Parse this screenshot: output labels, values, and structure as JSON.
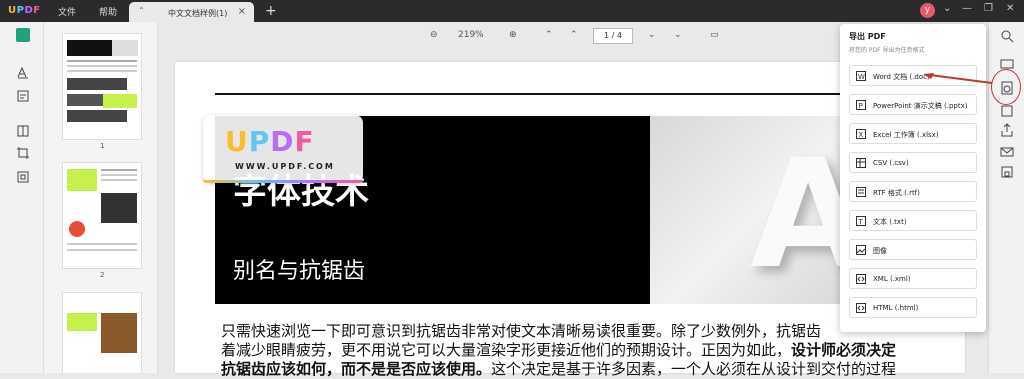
{
  "app": {
    "logo": "UPDF"
  },
  "menu": {
    "file": "文件",
    "help": "帮助"
  },
  "tab": {
    "title": "中文文档样例(1)"
  },
  "user": {
    "avatar_letter": "y"
  },
  "toolbar": {
    "zoom": "219%",
    "page_indicator": "1 / 4"
  },
  "thumbnails": [
    {
      "page": "1"
    },
    {
      "page": "2"
    }
  ],
  "document": {
    "watermark_url": "WWW.UPDF.COM",
    "heading": "字体技术",
    "subheading": "别名与抗锯齿",
    "big_letter": "A",
    "line1a": "只需快速浏览一下即可意识到抗锯齿非常对使文本清晰易读很重要。除了少数例外，抗锯齿",
    "line2": "着减少眼睛疲劳，更不用说它可以大量渲染字形更接近他们的预期设计。正因为如此，",
    "line2_bold": "设计师必须决定",
    "line3_bold": "抗锯齿应该如何，而不是是否应该使用。",
    "line3": "这个决定是基于许多因素，一个人必须在从设计到交付的过程"
  },
  "export_panel": {
    "title": "导出 PDF",
    "subtitle": "将您的 PDF 导出为任意格式",
    "options": [
      {
        "label": "Word 文档 (.doc)",
        "icon": "word-icon"
      },
      {
        "label": "PowerPoint 演示文稿 (.pptx)",
        "icon": "powerpoint-icon"
      },
      {
        "label": "Excel 工作簿 (.xlsx)",
        "icon": "excel-icon"
      },
      {
        "label": "CSV (.csv)",
        "icon": "csv-icon"
      },
      {
        "label": "RTF 格式 (.rtf)",
        "icon": "rtf-icon"
      },
      {
        "label": "文本 (.txt)",
        "icon": "text-icon"
      },
      {
        "label": "图像",
        "icon": "image-icon"
      },
      {
        "label": "XML (.xml)",
        "icon": "xml-icon"
      },
      {
        "label": "HTML (.html)",
        "icon": "html-icon"
      }
    ]
  },
  "colors": {
    "accent": "#20a37a",
    "annotation_red": "#c0392b",
    "lime": "#c6f04b"
  }
}
